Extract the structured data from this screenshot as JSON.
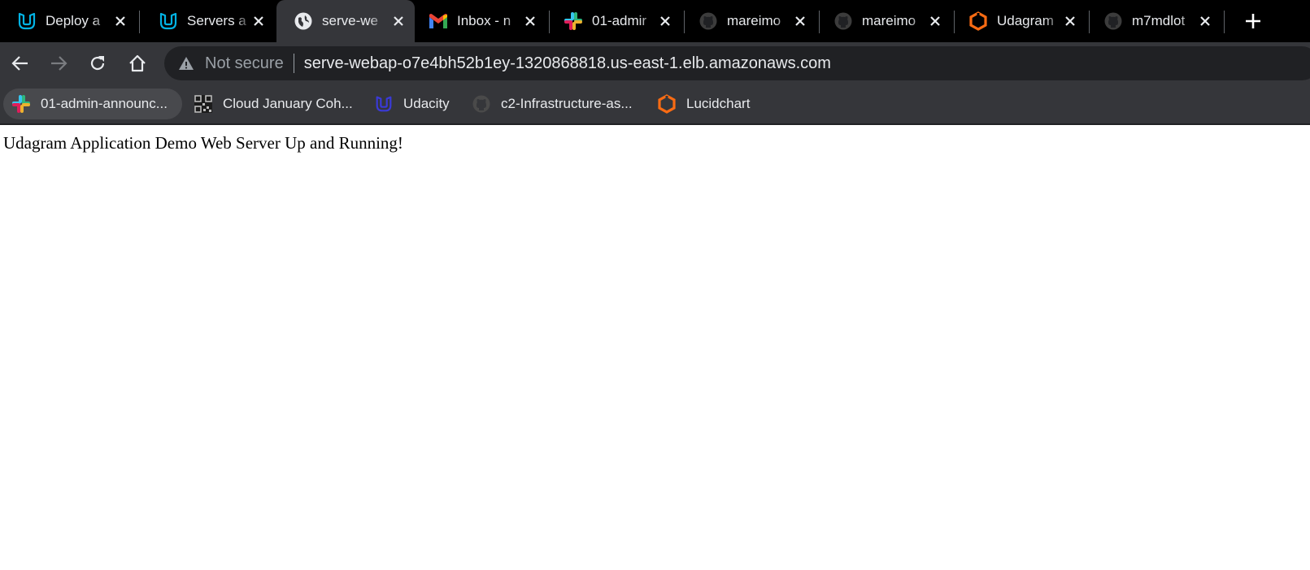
{
  "colors": {
    "tab_strip_bg": "#000000",
    "toolbar_bg": "#35363a",
    "omnibox_bg": "#202124",
    "text_light": "#e8eaed",
    "text_muted": "#9aa0a6",
    "udacity_blue": "#02b3e4",
    "lucid_orange": "#f96b13",
    "page_bg": "#ffffff"
  },
  "tabs": [
    {
      "title": "Deploy a",
      "icon": "udacity-icon",
      "active": false
    },
    {
      "title": "Servers a",
      "icon": "udacity-icon",
      "active": false
    },
    {
      "title": "serve-we",
      "icon": "globe-icon",
      "active": true
    },
    {
      "title": "Inbox - n",
      "icon": "gmail-icon",
      "active": false
    },
    {
      "title": "01-admir",
      "icon": "slack-icon",
      "active": false
    },
    {
      "title": "mareimo",
      "icon": "github-icon",
      "active": false
    },
    {
      "title": "mareimo",
      "icon": "github-icon",
      "active": false
    },
    {
      "title": "Udagram",
      "icon": "lucidchart-icon",
      "active": false
    },
    {
      "title": "m7mdlot",
      "icon": "github-icon",
      "active": false
    }
  ],
  "toolbar": {
    "security_label": "Not secure",
    "url": "serve-webap-o7e4bh52b1ey-1320868818.us-east-1.elb.amazonaws.com"
  },
  "bookmarks": [
    {
      "label": "01-admin-announc...",
      "icon": "slack-icon"
    },
    {
      "label": "Cloud January Coh...",
      "icon": "qr-icon"
    },
    {
      "label": "Udacity",
      "icon": "udacity-icon"
    },
    {
      "label": "c2-Infrastructure-as...",
      "icon": "github-icon"
    },
    {
      "label": "Lucidchart",
      "icon": "lucidchart-icon"
    }
  ],
  "page": {
    "text": "Udagram Application Demo Web Server Up and Running!"
  }
}
